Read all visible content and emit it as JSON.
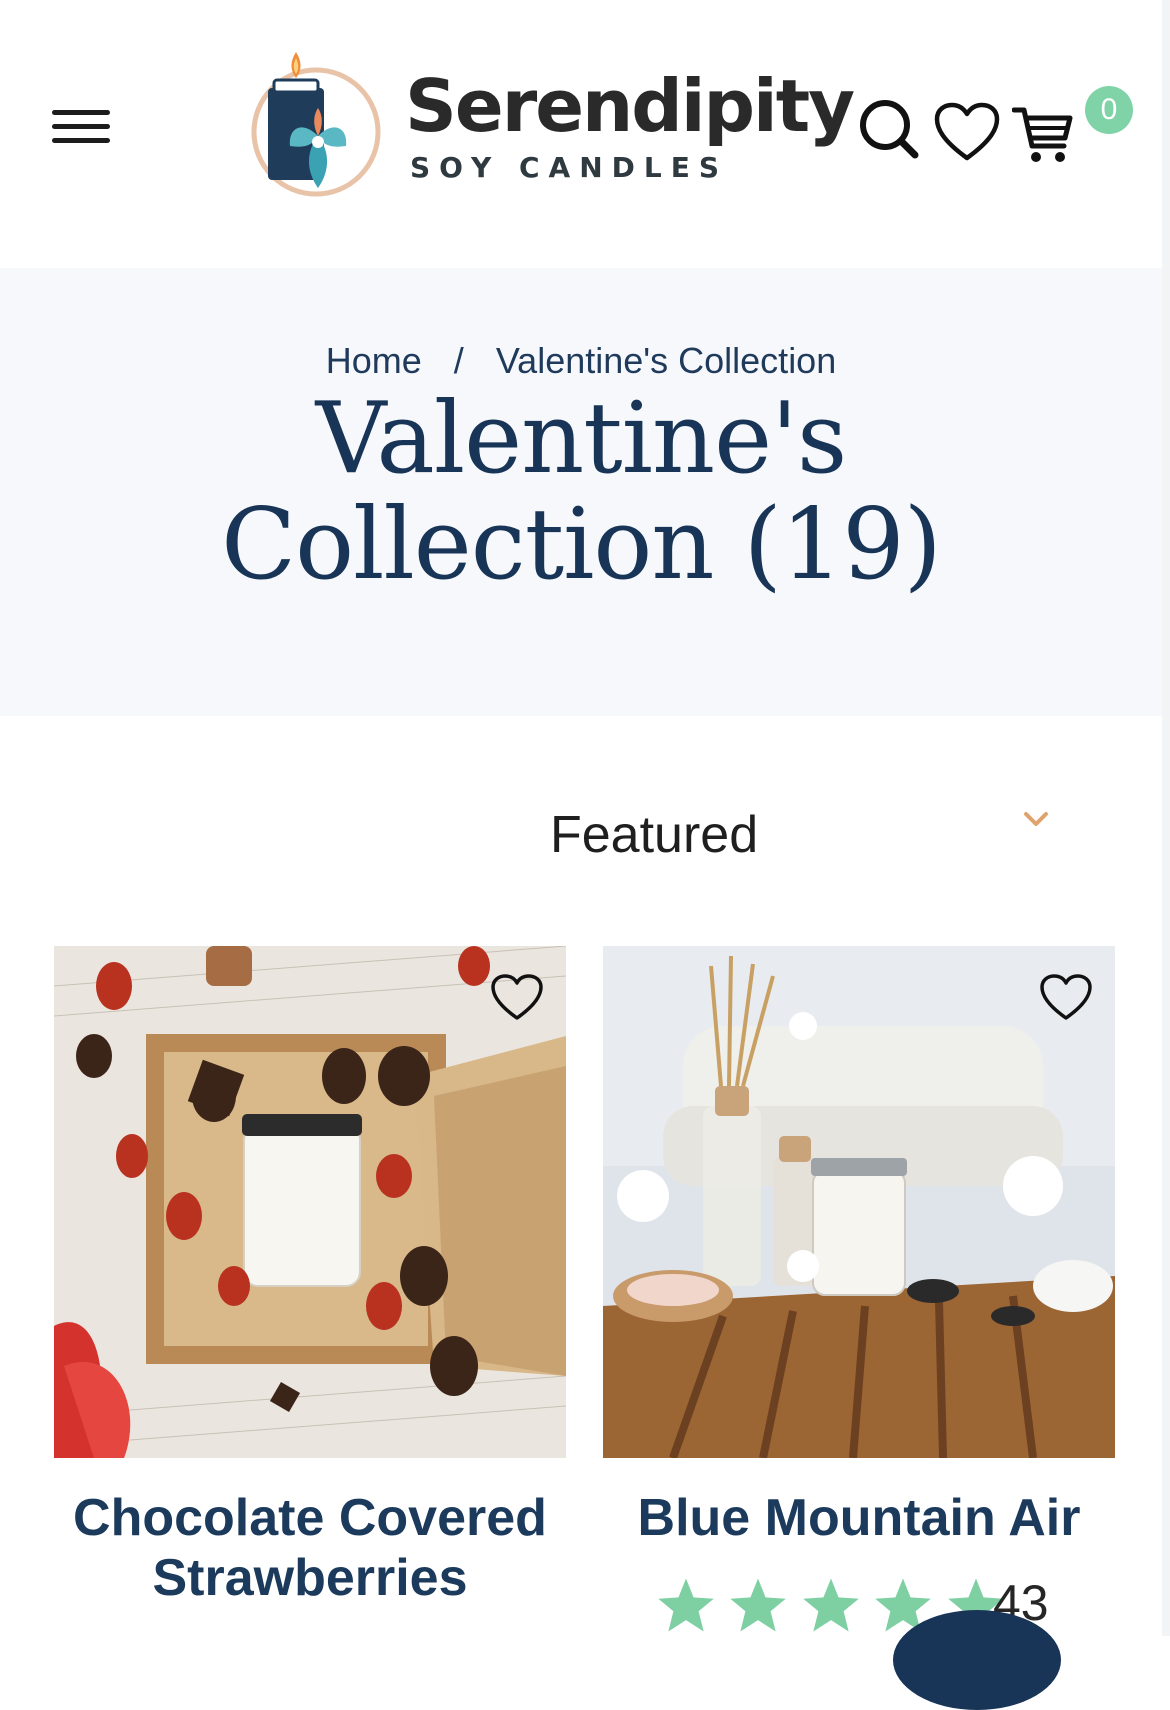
{
  "header": {
    "logo_text": "Serendipity",
    "logo_subtext": "SOY CANDLES",
    "cart_count": "0",
    "icons": [
      "menu-icon",
      "search-icon",
      "heart-icon",
      "cart-icon"
    ]
  },
  "breadcrumb": {
    "home": "Home",
    "separator": "/",
    "current": "Valentine's Collection"
  },
  "page_title": {
    "line1": "Valentine's",
    "line2": "Collection (19)"
  },
  "sort": {
    "selected": "Featured"
  },
  "products": [
    {
      "title_line1": "Chocolate Covered",
      "title_line2": "Strawberries"
    },
    {
      "title_line1": "Blue Mountain Air",
      "rating_stars": 5,
      "rating_count": "43"
    }
  ],
  "colors": {
    "brand_navy": "#183456",
    "accent_mint": "#7fd3a6",
    "hero_bg": "#f6f8fb"
  }
}
